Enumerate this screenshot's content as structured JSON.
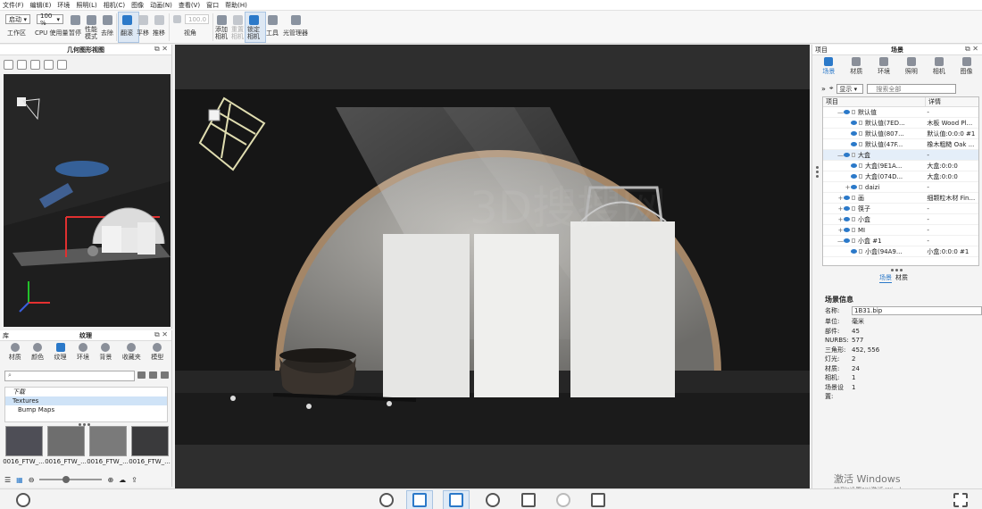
{
  "menu": [
    "文件(F)",
    "编辑(E)",
    "环境",
    "照明(L)",
    "相机(C)",
    "图像",
    "动画(N)",
    "查看(V)",
    "窗口",
    "帮助(H)"
  ],
  "toolbar": {
    "workspace_select": "启动",
    "workspace_label": "工作区",
    "cpu_percent": "100 %",
    "cpu_label": "CPU 使用量",
    "pause": "暂停",
    "perf_mode": "性能\n模式",
    "perf_mode_l1": "性能",
    "perf_mode_l2": "模式",
    "desaturate": "去除",
    "tumble": "翻滚",
    "pan": "平移",
    "dolly": "推移",
    "fov_value": "100.0",
    "perspective": "视角",
    "add_camera_l1": "添加",
    "add_camera_l2": "相机",
    "reset_camera_l1": "重置",
    "reset_camera_l2": "相机",
    "lock_camera_l1": "锁定",
    "lock_camera_l2": "相机",
    "tools": "工具",
    "light_manager": "光管理器"
  },
  "geometry_view": {
    "title": "几何图形视图"
  },
  "library": {
    "header_left": "库",
    "title": "纹理",
    "tabs": [
      {
        "label": "材质"
      },
      {
        "label": "颜色"
      },
      {
        "label": "纹理"
      },
      {
        "label": "环境"
      },
      {
        "label": "背景"
      },
      {
        "label": "收藏夹"
      },
      {
        "label": "模型"
      }
    ],
    "search_placeholder": "",
    "tree": [
      "下载",
      "Textures",
      "Bump Maps"
    ],
    "thumbnails": [
      {
        "label": "0016_FTW_...",
        "color": "#4e4e56"
      },
      {
        "label": "0016_FTW_...",
        "color": "#6e6e6e"
      },
      {
        "label": "0016_FTW_...",
        "color": "#7a7a7a"
      },
      {
        "label": "0016_FTW_...",
        "color": "#3a3a3c"
      }
    ]
  },
  "scene_panel": {
    "header_left": "项目",
    "title": "场景",
    "tabs": [
      {
        "label": "场景"
      },
      {
        "label": "材质"
      },
      {
        "label": "环境"
      },
      {
        "label": "照明"
      },
      {
        "label": "相机"
      },
      {
        "label": "图像"
      }
    ],
    "display_select": "显示",
    "search_placeholder": "搜索全部",
    "tree_headers": [
      "项目",
      "详情"
    ],
    "tree_rows": [
      {
        "name": "默认值",
        "detail": "-",
        "toggle": "—",
        "indent": 2
      },
      {
        "name": "默认值(7ED...",
        "detail": "木板 Wood Pl...",
        "toggle": "",
        "indent": 3
      },
      {
        "name": "默认值(807...",
        "detail": "默认值:0:0:0 #1",
        "toggle": "",
        "indent": 3
      },
      {
        "name": "默认值(47F...",
        "detail": "橡木粗糙 Oak ...",
        "toggle": "",
        "indent": 3
      },
      {
        "name": "大盒",
        "detail": "-",
        "toggle": "—",
        "indent": 2
      },
      {
        "name": "大盒(9E1A...",
        "detail": "大盒:0:0:0",
        "toggle": "",
        "indent": 3
      },
      {
        "name": "大盒(074D...",
        "detail": "大盒:0:0:0",
        "toggle": "",
        "indent": 3
      },
      {
        "name": "daizi",
        "detail": "-",
        "toggle": "+",
        "indent": 3
      },
      {
        "name": "画",
        "detail": "细颗粒木材 Fin...",
        "toggle": "+",
        "indent": 2
      },
      {
        "name": "筷子",
        "detail": "-",
        "toggle": "+",
        "indent": 2
      },
      {
        "name": "小盒",
        "detail": "-",
        "toggle": "+",
        "indent": 2
      },
      {
        "name": "MI",
        "detail": "-",
        "toggle": "+",
        "indent": 2
      },
      {
        "name": "小盒 #1",
        "detail": "-",
        "toggle": "—",
        "indent": 2
      },
      {
        "name": "小盒(94A9...",
        "detail": "小盒:0:0:0 #1",
        "toggle": "",
        "indent": 3
      }
    ],
    "subtabs": [
      "场景",
      "材质"
    ],
    "info": {
      "title": "场景信息",
      "name_label": "名称:",
      "name_value": "1B31.bip",
      "rows": [
        {
          "k": "单位:",
          "v": "毫米"
        },
        {
          "k": "部件:",
          "v": "45"
        },
        {
          "k": "NURBS:",
          "v": "577"
        },
        {
          "k": "三角形:",
          "v": "452, 556"
        },
        {
          "k": "灯光:",
          "v": "2"
        },
        {
          "k": "材质:",
          "v": "24"
        },
        {
          "k": "相机:",
          "v": "1"
        },
        {
          "k": "场景设置:",
          "v": "1"
        }
      ]
    }
  },
  "os_watermark": {
    "line1": "激活 Windows",
    "line2": "转到\"设置\"以激活 Windows。"
  },
  "colors": {
    "accent": "#2b79c9",
    "viewport_bg": "#2c2c2c"
  }
}
